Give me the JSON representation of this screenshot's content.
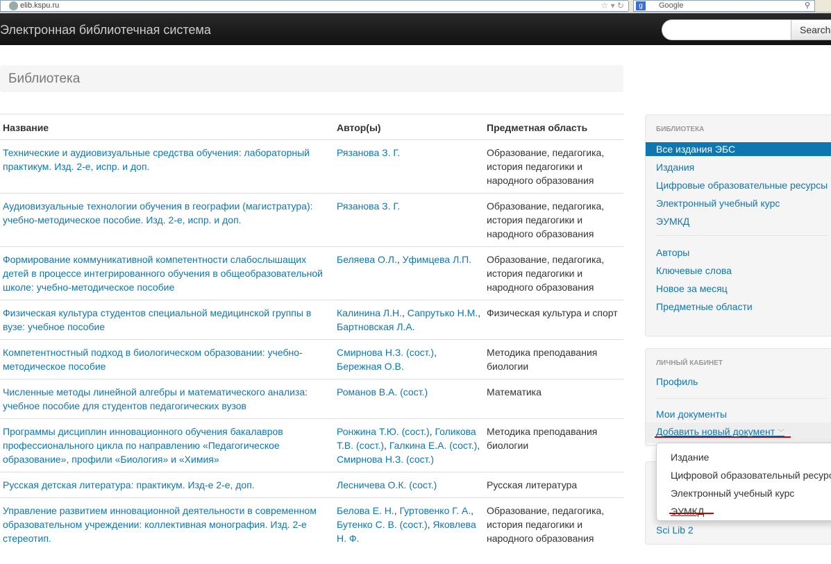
{
  "browser": {
    "url": "elib.kspu.ru",
    "search_engine": "Google"
  },
  "navbar": {
    "brand": "Электронная библиотечная система",
    "search_placeholder": "",
    "search_button": "Search"
  },
  "page": {
    "title": "Библиотека"
  },
  "table": {
    "headers": [
      "Название",
      "Автор(ы)",
      "Предметная область"
    ],
    "rows": [
      {
        "title": "Технические и аудиовизуальные средства обучения: лабораторный практикум. Изд. 2-е, испр. и доп.",
        "authors": [
          "Рязанова З. Г."
        ],
        "subject": "Образование, педагогика, история педагогики и народного образования"
      },
      {
        "title": "Аудиовизуальные технологии обучения в географии (магистратура): учебно-методическое пособие. Изд. 2-е, испр. и доп.",
        "authors": [
          "Рязанова З. Г."
        ],
        "subject": "Образование, педагогика, история педагогики и народного образования"
      },
      {
        "title": "Формирование коммуникативной компетентности слабослышащих детей в процессе интегрированного обучения в общеобразовательной школе: учебно-методическое пособие",
        "authors": [
          "Беляева О.Л.",
          "Уфимцева Л.П."
        ],
        "subject": "Образование, педагогика, история педагогики и народного образования"
      },
      {
        "title": "Физическая культура студентов специальной медицинской группы в вузе: учебное пособие",
        "authors": [
          "Калинина Л.Н.",
          "Сапрутько Н.М.",
          "Бартновская Л.А."
        ],
        "subject": "Физическая культура и спорт"
      },
      {
        "title": "Компетентностный подход в биологическом образовании: учебно-методическое пособие",
        "authors": [
          "Смирнова Н.З. (сост.)",
          "Бережная О.В."
        ],
        "subject": "Методика преподавания биологии"
      },
      {
        "title": "Численные методы линейной алгебры и математического анализа: учебное пособие для студентов педагогических вузов",
        "authors": [
          "Романов В.А. (сост.)"
        ],
        "subject": "Математика"
      },
      {
        "title": "Программы дисциплин инновационного обучения бакалавров профессионального цикла по направлению «Педагогическое образование», профили «Биология» и «Химия»",
        "authors": [
          "Ронжина Т.Ю. (сост.)",
          "Голикова Т.В. (сост.)",
          "Галкина Е.А. (сост.)",
          "Смирнова Н.З. (сост.)"
        ],
        "subject": "Методика преподавания биологии"
      },
      {
        "title": "Русская детская литература: практикум. Изд-е 2-е, доп.",
        "authors": [
          "Лесничева О.К. (сост.)"
        ],
        "subject": "Русская литература"
      },
      {
        "title": "Управление развитием инновационной деятельности в современном образовательном учреждении: коллективная монография. Изд. 2-е стереотип.",
        "authors": [
          "Белова Е. Н.",
          "Гуртовенко Г. А.",
          "Бутенко С. В. (сост.)",
          "Яковлева Н. Ф."
        ],
        "subject": "Образование, педагогика, история педагогики и народного образования"
      }
    ]
  },
  "sidebar": {
    "library": {
      "header": "Библиотека",
      "items": [
        "Все издания ЭБС",
        "Издания",
        "Цифровые образовательные ресурсы",
        "Электронный учебный курс",
        "ЭУМКД"
      ],
      "items2": [
        "Авторы",
        "Ключевые слова",
        "Новое за месяц",
        "Предметные области"
      ]
    },
    "cabinet": {
      "header": "Личный кабинет",
      "profile": "Профиль",
      "my_docs": "Мои документы",
      "add_doc": "Добавить новый документ"
    },
    "third": {
      "item": "Sci Lib 2"
    },
    "dropdown": [
      "Издание",
      "Цифровой образовательный ресурс",
      "Электронный учебный курс",
      "ЭУМКД"
    ]
  },
  "colors": {
    "link": "#0f76b0",
    "active": "#0f76b0",
    "navbar": "#1b1b1b",
    "annotation": "#cc0000"
  }
}
